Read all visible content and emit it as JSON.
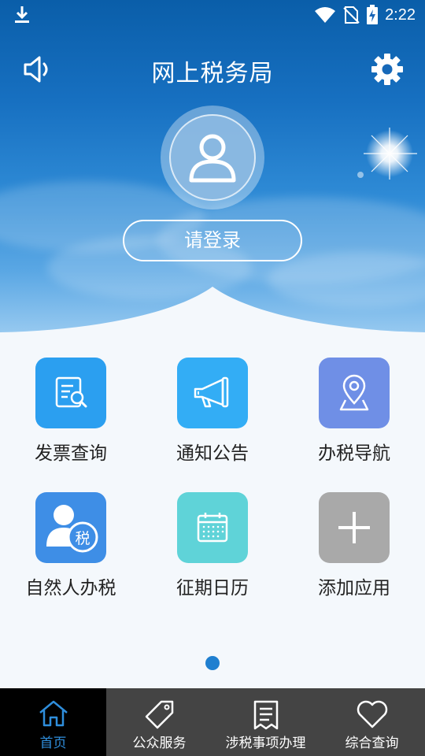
{
  "status_bar": {
    "time": "2:22"
  },
  "header": {
    "title": "网上税务局"
  },
  "login": {
    "label": "请登录"
  },
  "apps": [
    {
      "label": "发票查询",
      "icon": "invoice-search-icon",
      "color": "#2b9ff0"
    },
    {
      "label": "通知公告",
      "icon": "megaphone-icon",
      "color": "#33adf5"
    },
    {
      "label": "办税导航",
      "icon": "map-pin-icon",
      "color": "#6f8fe6"
    },
    {
      "label": "自然人办税",
      "icon": "person-tax-icon",
      "color": "#3e8ee6"
    },
    {
      "label": "征期日历",
      "icon": "calendar-icon",
      "color": "#5fd3d8"
    },
    {
      "label": "添加应用",
      "icon": "plus-icon",
      "color": "#a9a9a9"
    }
  ],
  "bottom_nav": [
    {
      "label": "首页",
      "icon": "home-icon",
      "active": true
    },
    {
      "label": "公众服务",
      "icon": "tag-icon",
      "active": false
    },
    {
      "label": "涉税事项办理",
      "icon": "document-icon",
      "active": false
    },
    {
      "label": "综合查询",
      "icon": "heart-icon",
      "active": false
    }
  ],
  "colors": {
    "active_nav": "#2f8edc",
    "nav_bg": "#444444",
    "page_dot": "#1f7fd0"
  }
}
